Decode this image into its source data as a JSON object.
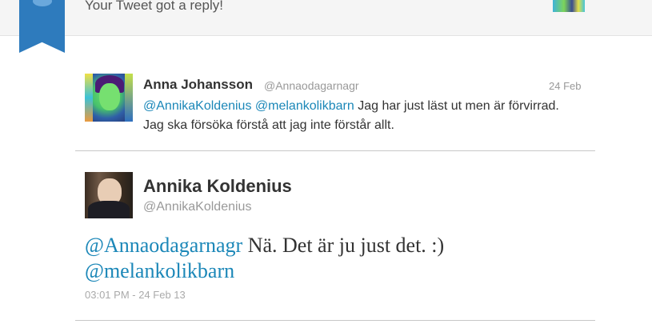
{
  "notification": {
    "text": "Your Tweet got a reply!"
  },
  "icons": {
    "ribbon": "bookmark-ribbon-icon",
    "bird": "twitter-bird-icon"
  },
  "colors": {
    "link": "#1b87b8",
    "ribbon": "#2e7bbd",
    "muted": "#999999"
  },
  "tweet1": {
    "name": "Anna Johansson",
    "handle": "@Annaodagarnagr",
    "date": "24 Feb",
    "mention1": "@AnnikaKoldenius",
    "mention2": "@melankolikbarn",
    "text": "Jag har just läst ut men är förvirrad. Jag ska försöka förstå att jag inte förstår allt."
  },
  "tweet2": {
    "name": "Annika Koldenius",
    "handle": "@AnnikaKoldenius",
    "mention1": "@Annaodagarnagr",
    "text": "Nä. Det är ju just det. :)",
    "mention2": "@melankolikbarn",
    "timestamp": "03:01 PM - 24 Feb 13"
  }
}
